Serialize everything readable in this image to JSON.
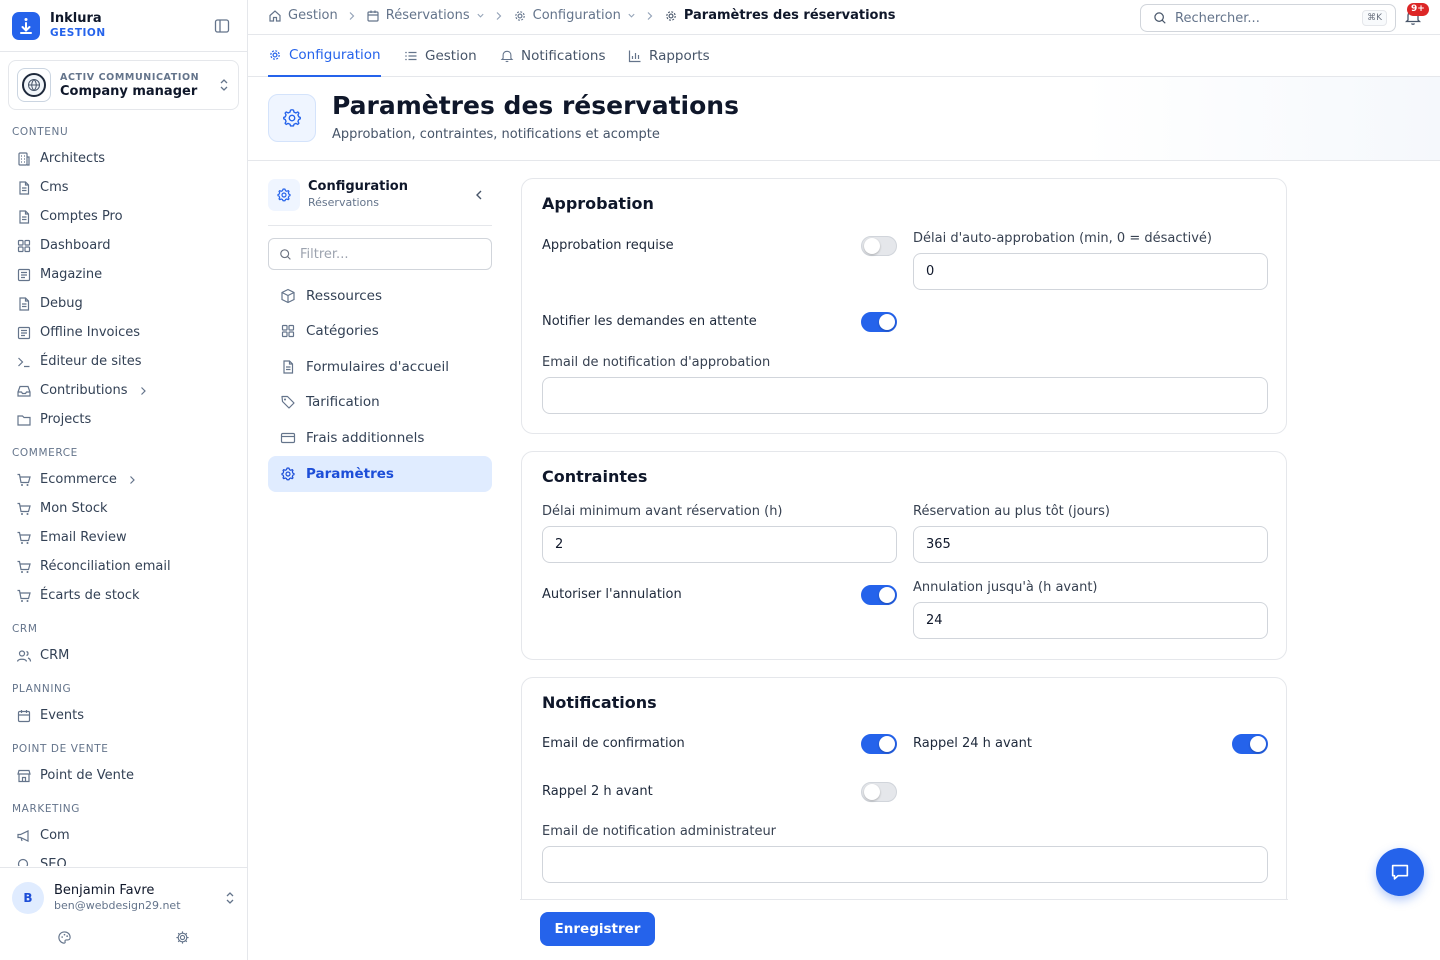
{
  "brand": {
    "name": "Inklura",
    "sub": "GESTION"
  },
  "org": {
    "name": "ACTIV COMMUNICATION",
    "role": "Company manager"
  },
  "nav": {
    "contenu": {
      "title": "CONTENU",
      "items": [
        "Architects",
        "Cms",
        "Comptes Pro",
        "Dashboard",
        "Magazine",
        "Debug",
        "Offline Invoices",
        "Éditeur de sites",
        "Contributions",
        "Projects"
      ]
    },
    "commerce": {
      "title": "COMMERCE",
      "items": [
        "Ecommerce",
        "Mon Stock",
        "Email Review",
        "Réconciliation email",
        "Écarts de stock"
      ]
    },
    "crm": {
      "title": "CRM",
      "items": [
        "CRM"
      ]
    },
    "planning": {
      "title": "PLANNING",
      "items": [
        "Events"
      ]
    },
    "pos": {
      "title": "POINT DE VENTE",
      "items": [
        "Point de Vente"
      ]
    },
    "marketing": {
      "title": "MARKETING",
      "items": [
        "Com",
        "SEO"
      ]
    }
  },
  "user": {
    "initial": "B",
    "name": "Benjamin Favre",
    "email": "ben@webdesign29.net"
  },
  "breadcrumb": [
    "Gestion",
    "Réservations",
    "Configuration",
    "Paramètres des réservations"
  ],
  "search": {
    "placeholder": "Rechercher...",
    "shortcut": "⌘K"
  },
  "notifications_badge": "9+",
  "tabs": [
    "Configuration",
    "Gestion",
    "Notifications",
    "Rapports"
  ],
  "page": {
    "title": "Paramètres des réservations",
    "subtitle": "Approbation, contraintes, notifications et acompte"
  },
  "subnav": {
    "title": "Configuration",
    "sub": "Réservations",
    "filter_placeholder": "Filtrer...",
    "items": [
      "Ressources",
      "Catégories",
      "Formulaires d'accueil",
      "Tarification",
      "Frais additionnels",
      "Paramètres"
    ]
  },
  "approbation": {
    "title": "Approbation",
    "required_label": "Approbation requise",
    "required_on": false,
    "auto_delay_label": "Délai d'auto-approbation (min, 0 = désactivé)",
    "auto_delay_value": "0",
    "notify_pending_label": "Notifier les demandes en attente",
    "notify_pending_on": true,
    "email_label": "Email de notification d'approbation",
    "email_value": ""
  },
  "contraintes": {
    "title": "Contraintes",
    "min_delay_label": "Délai minimum avant réservation (h)",
    "min_delay_value": "2",
    "earliest_label": "Réservation au plus tôt (jours)",
    "earliest_value": "365",
    "allow_cancel_label": "Autoriser l'annulation",
    "allow_cancel_on": true,
    "cancel_until_label": "Annulation jusqu'à (h avant)",
    "cancel_until_value": "24"
  },
  "notifs": {
    "title": "Notifications",
    "confirm_label": "Email de confirmation",
    "confirm_on": true,
    "reminder24_label": "Rappel 24 h avant",
    "reminder24_on": true,
    "reminder2_label": "Rappel 2 h avant",
    "reminder2_on": false,
    "admin_email_label": "Email de notification administrateur",
    "admin_email_value": ""
  },
  "save_label": "Enregistrer",
  "colors": {
    "accent": "#2563eb",
    "accent_soft": "#e0ecff",
    "badge": "#dc2626"
  }
}
